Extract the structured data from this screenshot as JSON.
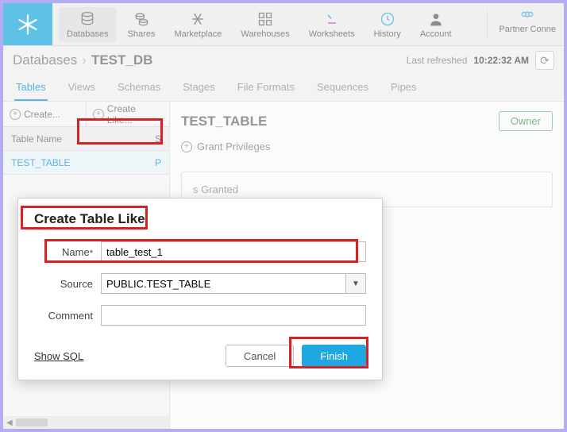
{
  "nav": {
    "databases": "Databases",
    "shares": "Shares",
    "marketplace": "Marketplace",
    "warehouses": "Warehouses",
    "worksheets": "Worksheets",
    "history": "History",
    "account": "Account",
    "partner": "Partner Conne"
  },
  "crumbs": {
    "root": "Databases",
    "current": "TEST_DB"
  },
  "refresh": {
    "label": "Last refreshed",
    "time": "10:22:32 AM"
  },
  "tabs": {
    "tables": "Tables",
    "views": "Views",
    "schemas": "Schemas",
    "stages": "Stages",
    "fileformats": "File Formats",
    "sequences": "Sequences",
    "pipes": "Pipes"
  },
  "left": {
    "create": "Create...",
    "create_like": "Create Like...",
    "header_name": "Table Name",
    "header_status": "S",
    "row_name": "TEST_TABLE",
    "row_status": "P"
  },
  "right": {
    "title": "TEST_TABLE",
    "owner": "Owner",
    "grant": "Grant Privileges",
    "panel": "s Granted"
  },
  "modal": {
    "title": "Create Table Like",
    "name_label": "Name",
    "name_req": "*",
    "name_value": "table_test_1",
    "source_label": "Source",
    "source_value": "PUBLIC.TEST_TABLE",
    "comment_label": "Comment",
    "comment_value": "",
    "show_sql": "Show SQL",
    "cancel": "Cancel",
    "finish": "Finish"
  }
}
